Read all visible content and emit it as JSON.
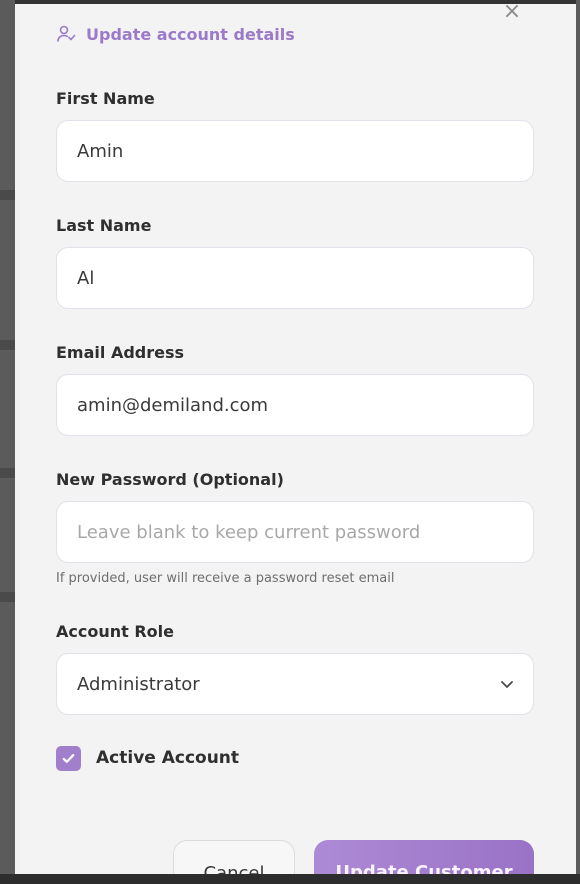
{
  "modal": {
    "header_title": "Update account details",
    "close_symbol": "×"
  },
  "form": {
    "first_name": {
      "label": "First Name",
      "value": "Amin"
    },
    "last_name": {
      "label": "Last Name",
      "value": "Al"
    },
    "email": {
      "label": "Email Address",
      "value": "amin@demiland.com"
    },
    "password": {
      "label": "New Password (Optional)",
      "placeholder": "Leave blank to keep current password",
      "hint": "If provided, user will receive a password reset email"
    },
    "role": {
      "label": "Account Role",
      "value": "Administrator"
    },
    "active": {
      "label": "Active Account",
      "checked": true
    }
  },
  "buttons": {
    "cancel": "Cancel",
    "submit": "Update Customer"
  },
  "colors": {
    "accent": "#9b7ac9",
    "checkbox": "#a27fcc",
    "button_gradient_start": "#ad8ad6",
    "button_gradient_end": "#9a72c6"
  }
}
